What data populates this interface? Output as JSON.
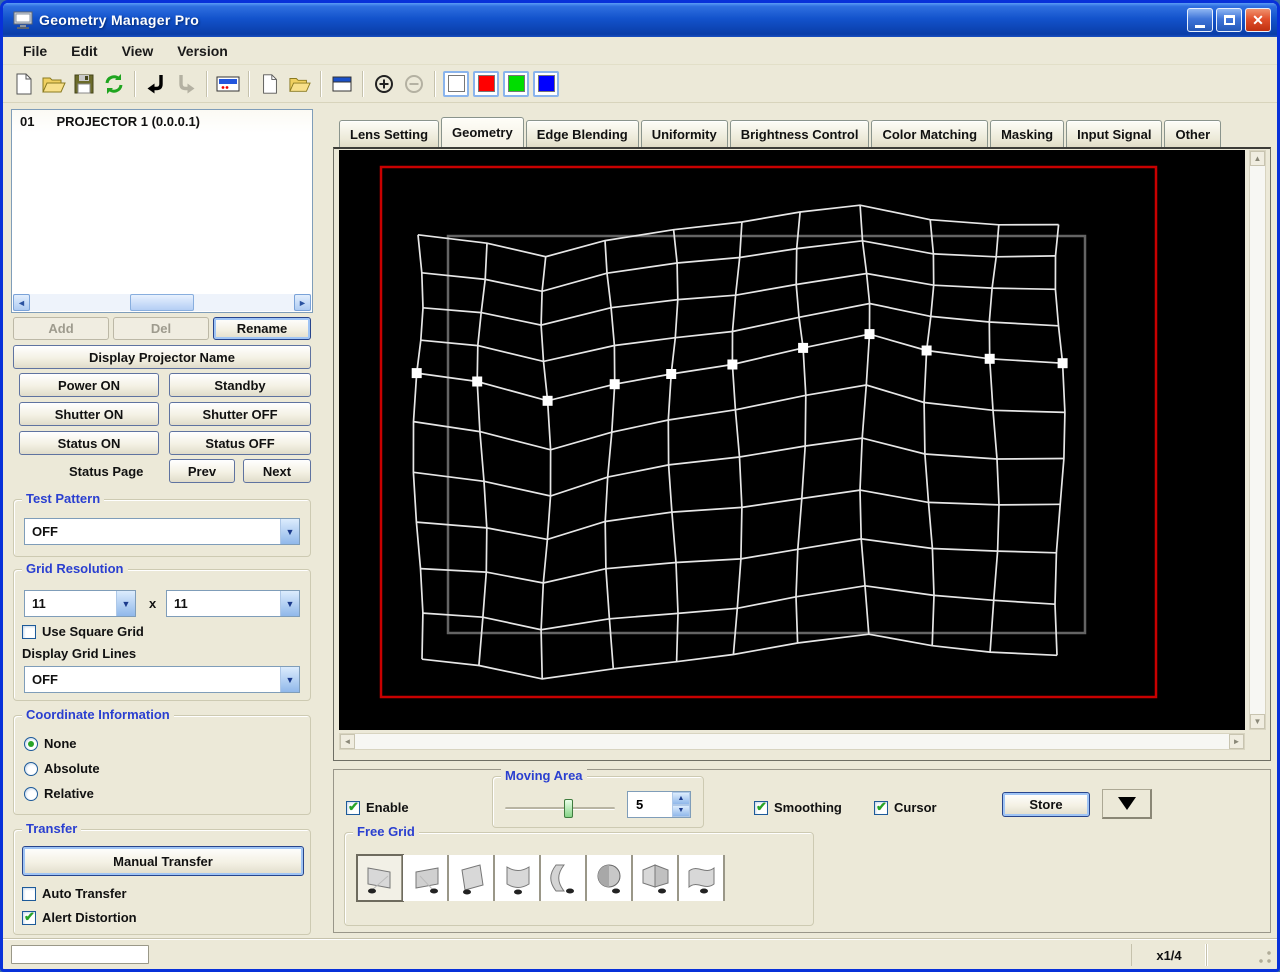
{
  "window": {
    "title": "Geometry Manager Pro"
  },
  "menu": {
    "items": [
      "File",
      "Edit",
      "View",
      "Version"
    ]
  },
  "toolbar": {
    "buttons": [
      {
        "icon": "new-file"
      },
      {
        "icon": "open-folder"
      },
      {
        "icon": "save"
      },
      {
        "icon": "refresh"
      },
      {
        "sep": true
      },
      {
        "icon": "return-left"
      },
      {
        "icon": "return-right",
        "disabled": true
      },
      {
        "sep": true
      },
      {
        "icon": "display-panel"
      },
      {
        "sep": true
      },
      {
        "icon": "new-file-small"
      },
      {
        "icon": "open-folder-small"
      },
      {
        "sep": true
      },
      {
        "icon": "window"
      },
      {
        "sep": true
      },
      {
        "icon": "zoom-in"
      },
      {
        "icon": "zoom-out",
        "disabled": true
      },
      {
        "sep": true
      },
      {
        "icon": "white-swatch",
        "swatch": "#ffffff"
      },
      {
        "icon": "red-swatch",
        "swatch": "#ff0000"
      },
      {
        "icon": "green-swatch",
        "swatch": "#00dd00"
      },
      {
        "icon": "blue-swatch",
        "swatch": "#0000ff"
      }
    ]
  },
  "projector_panel": {
    "list_item": {
      "index": "01",
      "name": "PROJECTOR 1 (0.0.0.1)"
    },
    "add": "Add",
    "del": "Del",
    "rename": "Rename",
    "display_projector_name": "Display Projector Name",
    "power_on": "Power ON",
    "standby": "Standby",
    "shutter_on": "Shutter ON",
    "shutter_off": "Shutter OFF",
    "status_on": "Status ON",
    "status_off": "Status OFF",
    "status_page_label": "Status Page",
    "prev": "Prev",
    "next": "Next",
    "test_pattern": {
      "label": "Test Pattern",
      "value": "OFF"
    },
    "grid_resolution": {
      "label": "Grid Resolution",
      "h_value": "11",
      "separator": "x",
      "v_value": "11",
      "use_square_grid": {
        "label": "Use Square Grid",
        "checked": false
      },
      "display_grid_lines_label": "Display Grid Lines",
      "display_grid_lines_value": "OFF"
    },
    "coordinate_information": {
      "label": "Coordinate Information",
      "options": [
        {
          "label": "None",
          "selected": true
        },
        {
          "label": "Absolute",
          "selected": false
        },
        {
          "label": "Relative",
          "selected": false
        }
      ]
    },
    "transfer": {
      "label": "Transfer",
      "manual_transfer": "Manual Transfer",
      "auto_transfer": {
        "label": "Auto Transfer",
        "checked": false
      },
      "alert_distortion": {
        "label": "Alert Distortion",
        "checked": true
      }
    }
  },
  "tabs": [
    {
      "label": "Lens Setting",
      "active": false
    },
    {
      "label": "Geometry",
      "active": true
    },
    {
      "label": "Edge Blending",
      "active": false
    },
    {
      "label": "Uniformity",
      "active": false
    },
    {
      "label": "Brightness Control",
      "active": false
    },
    {
      "label": "Color Matching",
      "active": false
    },
    {
      "label": "Masking",
      "active": false
    },
    {
      "label": "Input Signal",
      "active": false
    },
    {
      "label": "Other",
      "active": false
    }
  ],
  "canvas": {
    "background": "#000000",
    "boundary_color": "#c80000",
    "grid_color": "#e6e6e6",
    "reference_color": "#646464",
    "cols": 11,
    "rows": 11,
    "control_row": 4,
    "red_rect": [
      42,
      17,
      775,
      530
    ],
    "reference_rect": [
      109,
      86,
      637,
      397
    ],
    "control_points": {
      "x": [
        79,
        143,
        207,
        271,
        334,
        398,
        462,
        526,
        590,
        655,
        721
      ],
      "y": [
        226,
        234,
        251,
        232,
        221,
        213,
        199,
        187,
        203,
        209,
        211
      ]
    },
    "row_offsets": [
      -140,
      -105,
      -70,
      -35,
      0,
      48,
      96,
      144,
      192,
      240,
      288
    ]
  },
  "bottom_panel": {
    "enable": {
      "label": "Enable",
      "checked": true
    },
    "moving_area": {
      "label": "Moving Area",
      "value": "5",
      "slider_percent": 58
    },
    "smoothing": {
      "label": "Smoothing",
      "checked": true
    },
    "cursor": {
      "label": "Cursor",
      "checked": true
    },
    "store": "Store",
    "free_grid": {
      "label": "Free Grid",
      "icons": [
        "flat-screen-left",
        "flat-screen-right",
        "flat-screen-tilt",
        "cylinder-vertical",
        "cylinder-horizontal",
        "sphere",
        "corner-screen",
        "curved-screen"
      ],
      "selected_index": 0
    }
  },
  "status_bar": {
    "zoom": "x1/4"
  }
}
